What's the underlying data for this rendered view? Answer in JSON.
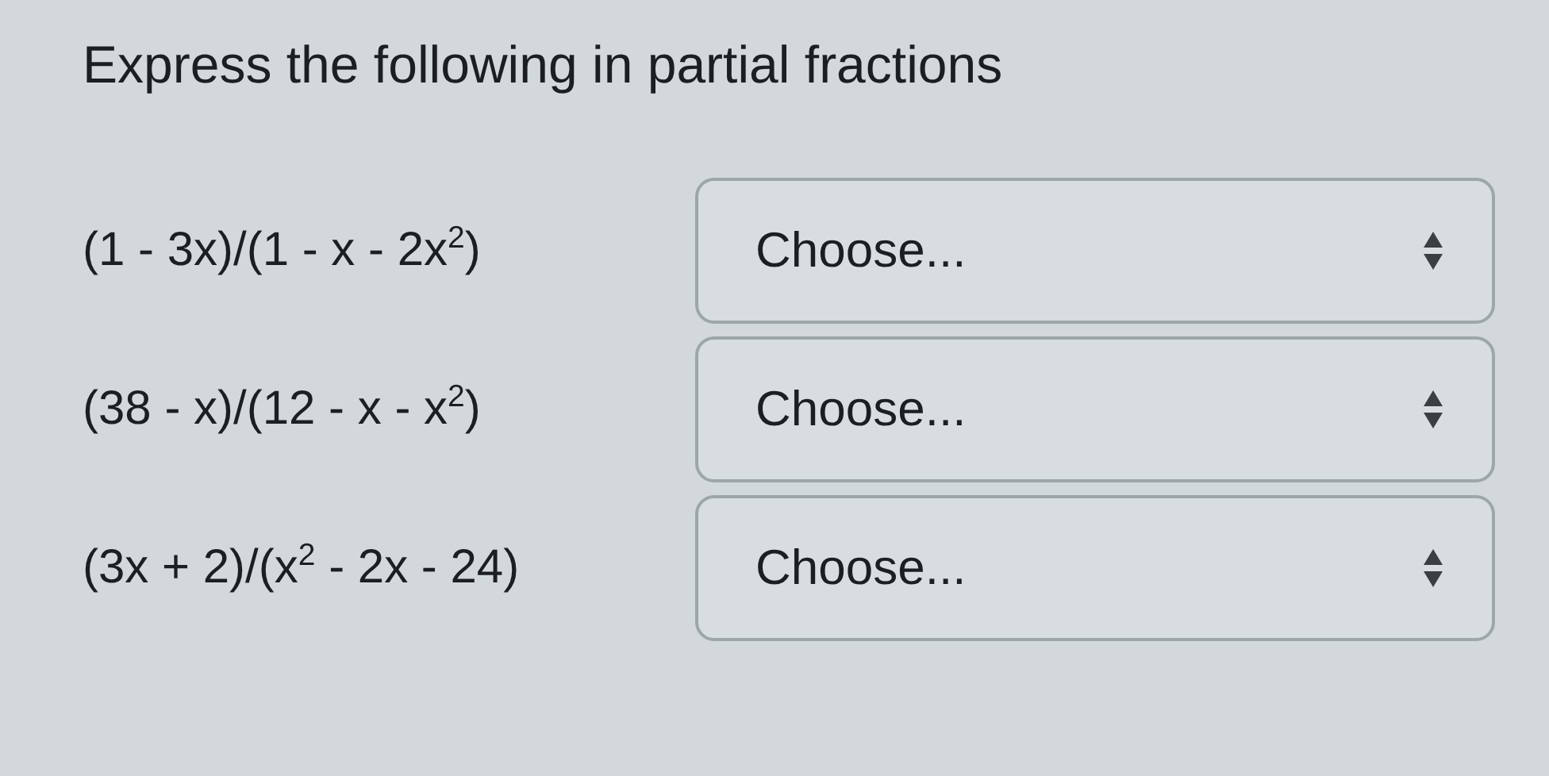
{
  "title": "Express the following in partial fractions",
  "questions": [
    {
      "expression": "(1 - 3x)/(1 - x - 2x$^{2}$)",
      "answer": "Choose..."
    },
    {
      "expression": "(38 - x)/(12 - x - x$^{2}$)",
      "answer": "Choose..."
    },
    {
      "expression": "(3x + 2)/(x$^{2}$ - 2x - 24)",
      "answer": "Choose..."
    }
  ]
}
